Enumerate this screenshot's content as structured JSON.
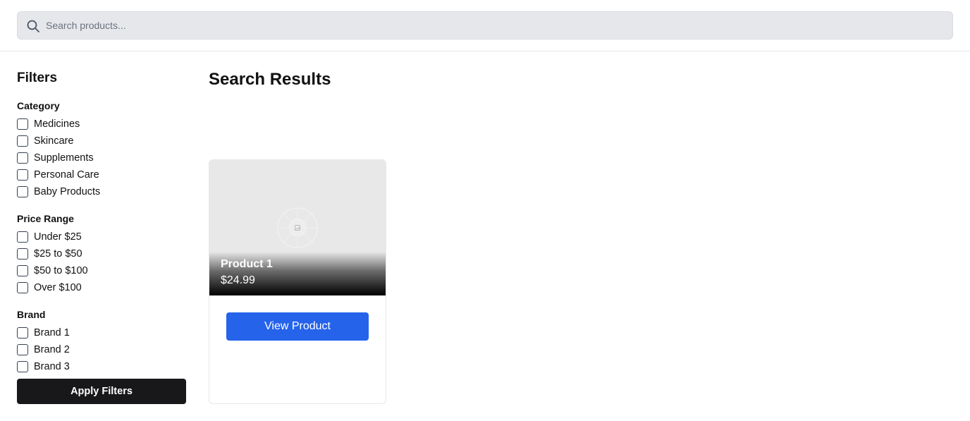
{
  "search": {
    "placeholder": "Search products...",
    "value": ""
  },
  "filters": {
    "title": "Filters",
    "groups": [
      {
        "title": "Category",
        "options": [
          "Medicines",
          "Skincare",
          "Supplements",
          "Personal Care",
          "Baby Products"
        ]
      },
      {
        "title": "Price Range",
        "options": [
          "Under $25",
          "$25 to $50",
          "$50 to $100",
          "Over $100"
        ]
      },
      {
        "title": "Brand",
        "options": [
          "Brand 1",
          "Brand 2",
          "Brand 3"
        ]
      }
    ],
    "apply_label": "Apply Filters"
  },
  "results": {
    "title": "Search Results",
    "products": [
      {
        "name": "Product 1",
        "price": "$24.99",
        "button_label": "View Product"
      }
    ]
  },
  "colors": {
    "accent": "#2563eb",
    "apply_button": "#18181b",
    "search_bg": "#e5e7eb"
  },
  "icons": {
    "search": "search-icon",
    "image_placeholder": "image-placeholder-icon"
  }
}
